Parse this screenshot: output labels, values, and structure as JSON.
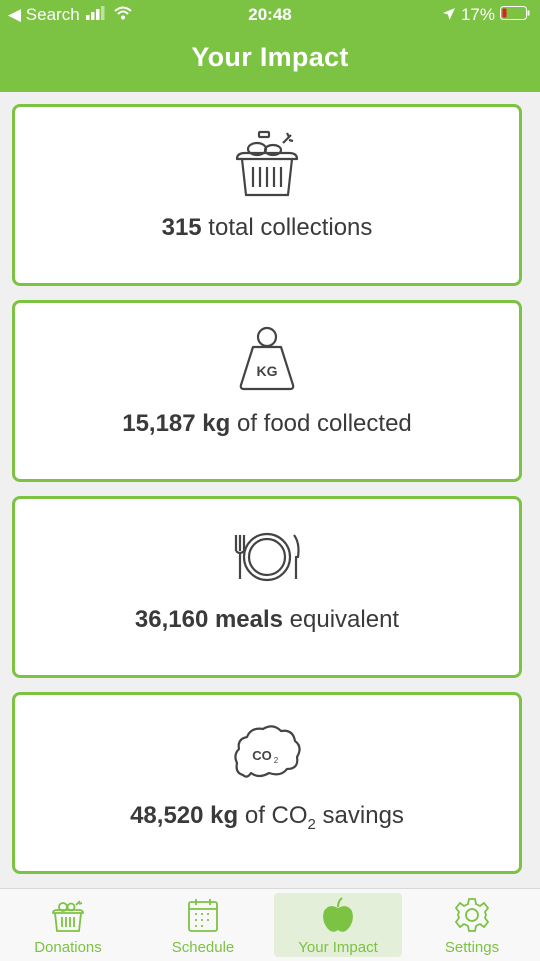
{
  "status_bar": {
    "back_label": "◀ Search",
    "time": "20:48",
    "battery": "17%"
  },
  "header": {
    "title": "Your Impact"
  },
  "cards": [
    {
      "value": "315",
      "label": " total collections",
      "icon": "basket-icon"
    },
    {
      "value": "15,187 kg",
      "label": " of food collected",
      "icon": "weight-kg-icon",
      "icon_text": "KG"
    },
    {
      "value": "36,160 meals",
      "label": " equivalent",
      "icon": "plate-fork-knife-icon"
    },
    {
      "value": "48,520 kg",
      "label_pre": " of CO",
      "label_sub": "2",
      "label_post": " savings",
      "icon": "co2-cloud-icon",
      "icon_text": "CO",
      "icon_sub": "2"
    }
  ],
  "tabbar": {
    "tabs": [
      {
        "label": "Donations",
        "icon": "basket-icon",
        "active": false
      },
      {
        "label": "Schedule",
        "icon": "calendar-icon",
        "active": false
      },
      {
        "label": "Your Impact",
        "icon": "apple-icon",
        "active": true
      },
      {
        "label": "Settings",
        "icon": "gear-icon",
        "active": false
      }
    ]
  },
  "colors": {
    "accent": "#7cc243",
    "text": "#3a3a3a",
    "active_tab_bg": "#e3efd8"
  }
}
